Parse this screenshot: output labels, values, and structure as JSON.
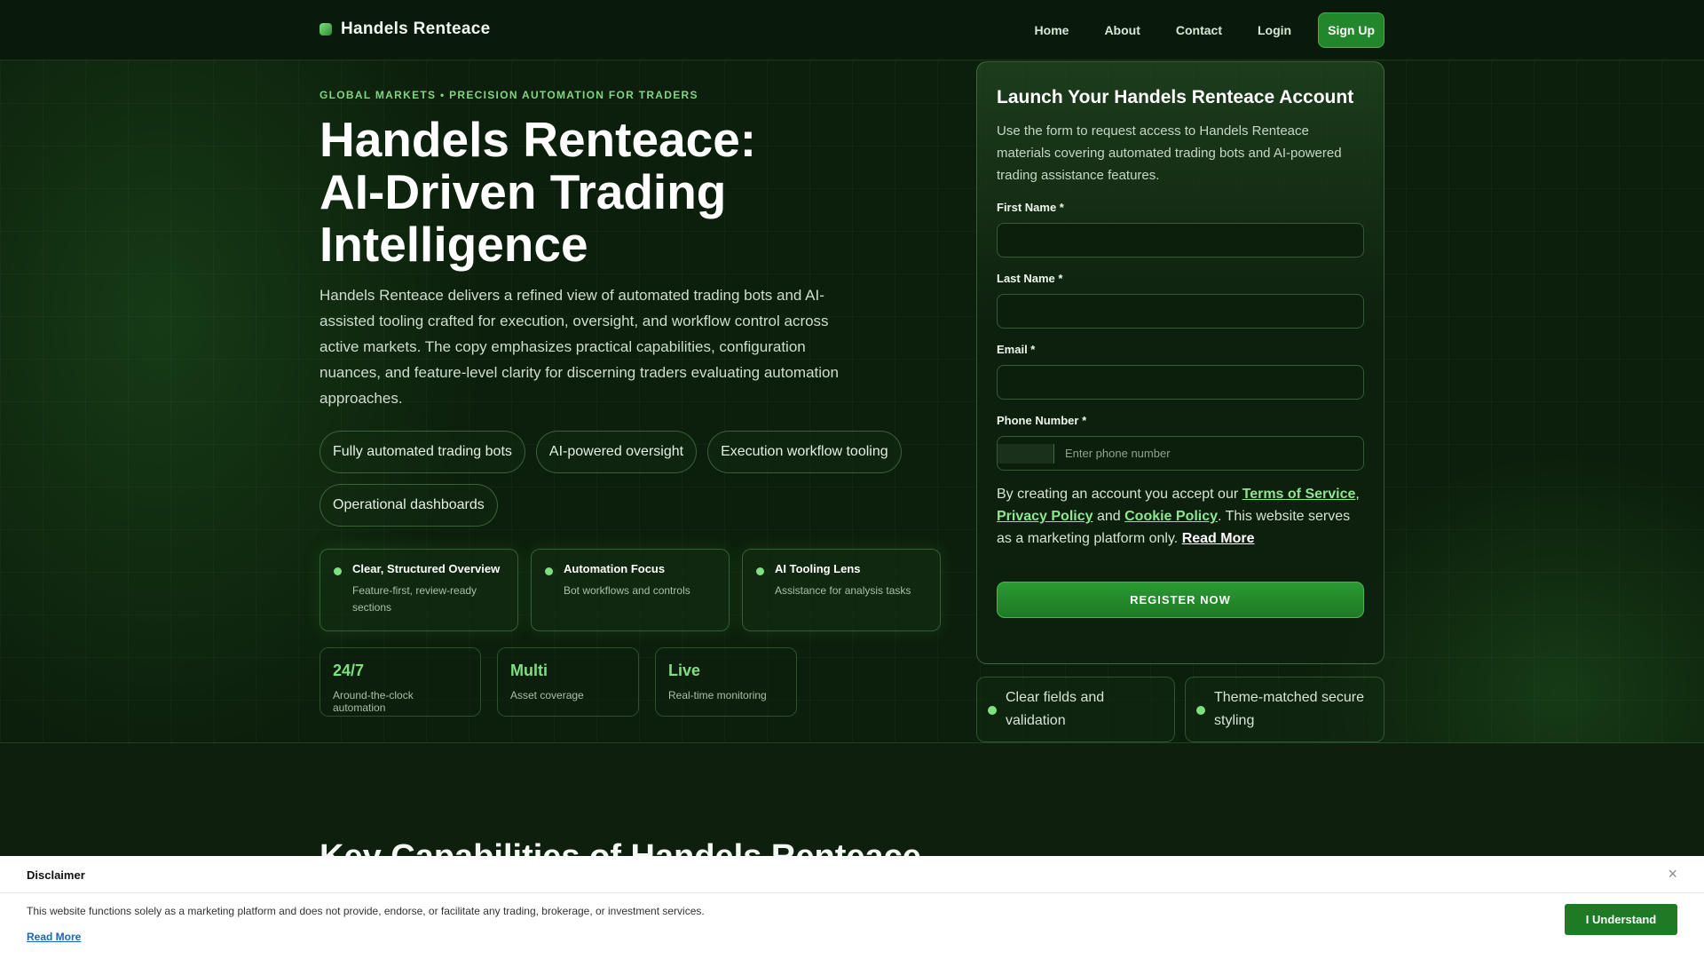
{
  "nav": {
    "brand": "Handels Renteace",
    "links": [
      "Home",
      "About",
      "Contact",
      "Login"
    ],
    "signup": "Sign Up"
  },
  "hero": {
    "eyebrow": "GLOBAL MARKETS • PRECISION AUTOMATION FOR TRADERS",
    "title_lines": [
      "Handels Renteace:",
      "AI-Driven Trading",
      "Intelligence"
    ],
    "lead": "Handels Renteace delivers a refined view of automated trading bots and AI-assisted tooling crafted for execution, oversight, and workflow control across active markets. The copy emphasizes practical capabilities, configuration nuances, and feature-level clarity for discerning traders evaluating automation approaches.",
    "pills": [
      "Fully automated trading bots",
      "AI-powered oversight",
      "Execution workflow tooling",
      "Operational dashboards"
    ],
    "features": [
      {
        "title": "Clear, Structured Overview",
        "desc": "Feature-first, review-ready sections"
      },
      {
        "title": "Automation Focus",
        "desc": "Bot workflows and controls"
      },
      {
        "title": "AI Tooling Lens",
        "desc": "Assistance for analysis tasks"
      }
    ],
    "stats": [
      {
        "value": "24/7",
        "label": "Around-the-clock automation"
      },
      {
        "value": "Multi",
        "label": "Asset coverage"
      },
      {
        "value": "Live",
        "label": "Real-time monitoring"
      }
    ]
  },
  "form": {
    "title": "Launch Your Handels Renteace Account",
    "desc": "Use the form to request access to Handels Renteace materials covering automated trading bots and AI-powered trading assistance features.",
    "first_name_label": "First Name *",
    "last_name_label": "Last Name *",
    "email_label": "Email *",
    "phone_label": "Phone Number *",
    "phone_placeholder": "Enter phone number",
    "terms_prefix": "By creating an account you accept our ",
    "terms_link": "Terms of Service",
    "terms_comma": ",",
    "privacy_link": "Privacy Policy",
    "and": " and ",
    "cookie_link": "Cookie Policy",
    "terms_suffix": ". This website serves as a marketing platform only. ",
    "read_more": "Read More",
    "register": "REGISTER NOW"
  },
  "mini_cards": [
    "Clear fields and validation",
    "Theme-matched secure styling"
  ],
  "capabilities_title": "Key Capabilities of Handels Renteace",
  "disclaimer": {
    "title": "Disclaimer",
    "close": "×",
    "text": "This website functions solely as a marketing platform and does not provide, endorse, or facilitate any trading, brokerage, or investment services.",
    "read_more": "Read More",
    "button": "I Understand"
  }
}
